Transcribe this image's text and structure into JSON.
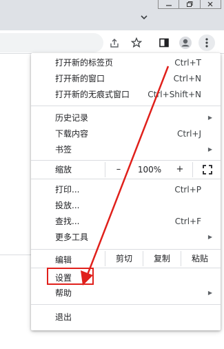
{
  "menu": {
    "new_tab": {
      "label": "打开新的标签页",
      "shortcut": "Ctrl+T"
    },
    "new_window": {
      "label": "打开新的窗口",
      "shortcut": "Ctrl+N"
    },
    "incognito": {
      "label": "打开新的无痕式窗口",
      "shortcut": "Ctrl+Shift+N"
    },
    "history": {
      "label": "历史记录"
    },
    "downloads": {
      "label": "下载内容",
      "shortcut": "Ctrl+J"
    },
    "bookmarks": {
      "label": "书签"
    },
    "zoom": {
      "label": "缩放",
      "minus": "–",
      "value": "100%",
      "plus": "+"
    },
    "print": {
      "label": "打印...",
      "shortcut": "Ctrl+P"
    },
    "cast": {
      "label": "投放..."
    },
    "find": {
      "label": "查找...",
      "shortcut": "Ctrl+F"
    },
    "more_tools": {
      "label": "更多工具"
    },
    "edit": {
      "label": "编辑",
      "cut": "剪切",
      "copy": "复制",
      "paste": "粘贴"
    },
    "settings": {
      "label": "设置"
    },
    "help": {
      "label": "帮助"
    },
    "exit": {
      "label": "退出"
    }
  },
  "colors": {
    "annotation": "#e0201b",
    "chrome": "#dee1e6"
  },
  "icons": [
    "minimize-icon",
    "restore-icon",
    "close-icon",
    "chevron-down-icon",
    "share-icon",
    "star-icon",
    "side-panel-icon",
    "profile-icon",
    "kebab-menu-icon",
    "fullscreen-icon",
    "submenu-arrow-icon"
  ]
}
